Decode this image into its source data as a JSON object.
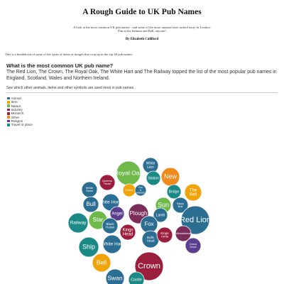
{
  "title": "A Rough Guide to UK Pub Names",
  "subtitle_lines": [
    "A look at the most common UK pub names - and some of the more unusual ones tucked away in London.",
    "Pint at the Salmon and Ball, anyone?"
  ],
  "byline": "By Elizabeth Culliford",
  "intro": "This is a breakdown of some of the types of items or images that crop up in the top 60 pub names.",
  "heading": "What is the most common UK pub name?",
  "lead": "The Red Lion, The Crown, The Royal Oak, The White Hart and The Railway topped the list of the most popular pub names in England, Scotland, Wales and Northern Ireland.",
  "see_which": "See which other animals, items and other symbols are used most in pub names",
  "legend": [
    {
      "label": "Animal",
      "color": "#2c6e91"
    },
    {
      "label": "Item",
      "color": "#f0a30a"
    },
    {
      "label": "Nature",
      "color": "#6fb94a"
    },
    {
      "label": "Industry",
      "color": "#7b2d5a"
    },
    {
      "label": "Monarch",
      "color": "#9b1e3d"
    },
    {
      "label": "Other",
      "color": "#f08a1c"
    },
    {
      "label": "Religion",
      "color": "#5b3e8f"
    },
    {
      "label": "Travel or place",
      "color": "#1b8a86"
    }
  ],
  "bubbles": [
    {
      "label": "Royal Oak",
      "category": "Nature"
    },
    {
      "label": "White Lion",
      "category": "Animal"
    },
    {
      "label": "New",
      "category": "Other"
    },
    {
      "label": "Queens Head",
      "category": "Monarch"
    },
    {
      "label": "Station",
      "category": "Travel or place"
    },
    {
      "label": "White Swan",
      "category": "Animal"
    },
    {
      "label": "Globe",
      "category": "Item"
    },
    {
      "label": "Fox & Hounds",
      "category": "Animal"
    },
    {
      "label": "Bridge",
      "category": "Travel or place"
    },
    {
      "label": "The Bell",
      "category": "Item"
    },
    {
      "label": "Bull",
      "category": "Animal"
    },
    {
      "label": "White Horse",
      "category": "Animal"
    },
    {
      "label": "Sun",
      "category": "Nature"
    },
    {
      "label": "Black Bull",
      "category": "Animal"
    },
    {
      "label": "Angel",
      "category": "Religion"
    },
    {
      "label": "Plough",
      "category": "Industry"
    },
    {
      "label": "Lamb",
      "category": "Animal"
    },
    {
      "label": "Red Lion",
      "category": "Animal"
    },
    {
      "label": "Railway",
      "category": "Travel or place"
    },
    {
      "label": "Star",
      "category": "Nature"
    },
    {
      "label": "Black Horse",
      "category": "Animal"
    },
    {
      "label": "Fox",
      "category": "Animal"
    },
    {
      "label": "Wheatsheaf",
      "category": "Industry"
    },
    {
      "label": "Kings Head",
      "category": "Monarch"
    },
    {
      "label": "Ship",
      "category": "Travel or place"
    },
    {
      "label": "White Hart",
      "category": "Animal"
    },
    {
      "label": "Bulls Head",
      "category": "Animal"
    },
    {
      "label": "Kings Arms",
      "category": "Monarch"
    },
    {
      "label": "Cross Keys",
      "category": "Religion"
    },
    {
      "label": "Bell",
      "category": "Item"
    },
    {
      "label": "Crown",
      "category": "Monarch"
    },
    {
      "label": "Swan",
      "category": "Animal"
    },
    {
      "label": "Castle",
      "category": "Travel or place"
    }
  ]
}
